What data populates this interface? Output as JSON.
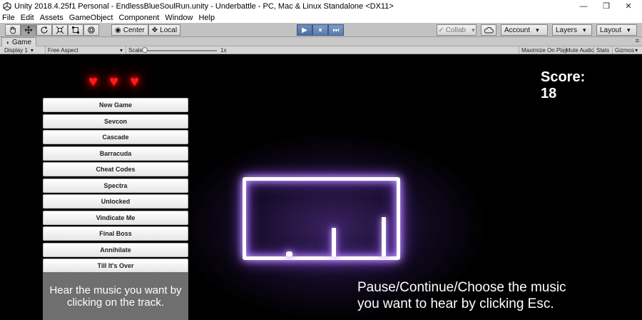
{
  "window": {
    "title": "Unity 2018.4.25f1 Personal - EndlessBlueSoulRun.unity - Underbattle - PC, Mac & Linux Standalone <DX11>",
    "controls": {
      "minimize": "—",
      "restore": "❐",
      "close": "✕"
    }
  },
  "menu": [
    "File",
    "Edit",
    "Assets",
    "GameObject",
    "Component",
    "Window",
    "Help"
  ],
  "toolbar": {
    "pivot_label": "Center",
    "space_label": "Local",
    "collab_label": "Collab",
    "account_label": "Account",
    "layers_label": "Layers",
    "layout_label": "Layout",
    "play_glyph": "▶",
    "pause_glyph": "⏸",
    "step_glyph": "⏭"
  },
  "game_tab": {
    "label": "Game"
  },
  "game_view_bar": {
    "display": "Display 1",
    "aspect": "Free Aspect",
    "scale_label": "Scale",
    "scale_value": "1x",
    "maximize_on_play": "Maximize On Play",
    "mute_audio": "Mute Audio",
    "stats": "Stats",
    "gizmos": "Gizmos"
  },
  "game": {
    "lives": 3,
    "heart_glyph": "♥",
    "score_label": "Score:",
    "score_value": "18",
    "tracks": [
      "New Game",
      "Sevcon",
      "Cascade",
      "Barracuda",
      "Cheat Codes",
      "Spectra",
      "Unlocked",
      "Vindicate Me",
      "Final Boss",
      "Annihilate",
      "Till It's Over"
    ],
    "track_hint": "Hear the music you want by clicking on the track.",
    "esc_hint_line1": "Pause/Continue/Choose the music",
    "esc_hint_line2": "you want to hear by clicking Esc."
  },
  "colors": {
    "heart": "#ff1a1a",
    "neon_glow": "#9b59ff",
    "play_button": "#4c6ea3",
    "hint_panel": "#6f6f6f"
  }
}
